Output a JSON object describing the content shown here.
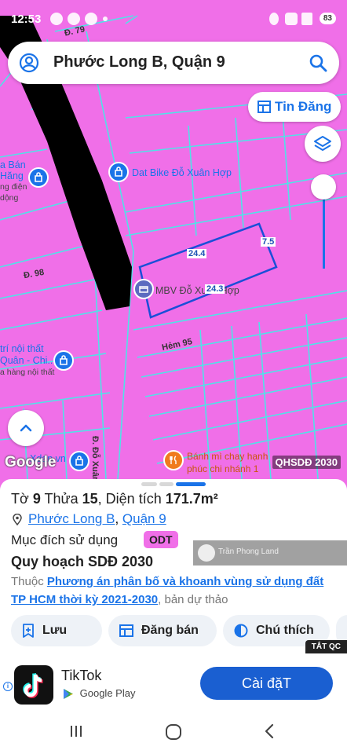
{
  "status_bar": {
    "time": "12:53",
    "battery": "83"
  },
  "search": {
    "title": "Phước Long B, Quận 9"
  },
  "tin_dang_button": {
    "label": "Tin Đăng"
  },
  "map": {
    "road_labels": [
      "Đ. 79",
      "Đ. 98",
      "Hẻm 95",
      "Đ. Đỗ Xuân"
    ],
    "poi": {
      "dat_bike": "Dat Bike Đỗ Xuân Hợp",
      "mbv": "MBV Đỗ Xuân Hợp",
      "banh_mi": "Bánh mì chay hạnh phúc chi nhánh 1",
      "left_top": [
        "a Bán",
        "Hăng",
        "ng điện",
        "dộng"
      ],
      "left_mid": [
        "trí nội thất",
        "Quân - Chi...",
        "a hàng nội thất"
      ],
      "left_bottom": "Xdan vn"
    },
    "parcel_dims": [
      "24.4",
      "7.5",
      "24.3"
    ],
    "google_logo": "Google",
    "map_code": "QHSDĐ 2030",
    "colors": {
      "land_use_pink": "#f06fe8",
      "parcel_lines": "#4fe3e7",
      "road_black": "#000000"
    }
  },
  "sheet": {
    "parcel": {
      "to_label": "Tờ",
      "to": "9",
      "thua_label": "Thửa",
      "thua": "15",
      "area_label": "Diện tích",
      "area": "171.7m²"
    },
    "address": {
      "ward": "Phước Long B",
      "sep": ", ",
      "district": "Quận 9"
    },
    "purpose_label": "Mục đích sử dụng",
    "purpose_code": "ODT",
    "plan_title": "Quy hoạch SDĐ 2030",
    "plan_desc_prefix": "Thuộc",
    "plan_desc_link": "Phương án phân bố và khoanh vùng sử dụng đất TP HCM thời kỳ 2021-2030",
    "plan_desc_suffix": ", bản dự thảo",
    "watermark": "Trần Phong Land",
    "actions": {
      "save": "Lưu",
      "post": "Đăng bán",
      "legend": "Chú thích"
    },
    "hide_ads": "TẮT QC"
  },
  "ad": {
    "app_name": "TikTok",
    "store": "Google Play",
    "install": "Cài đặT",
    "info": "i"
  }
}
